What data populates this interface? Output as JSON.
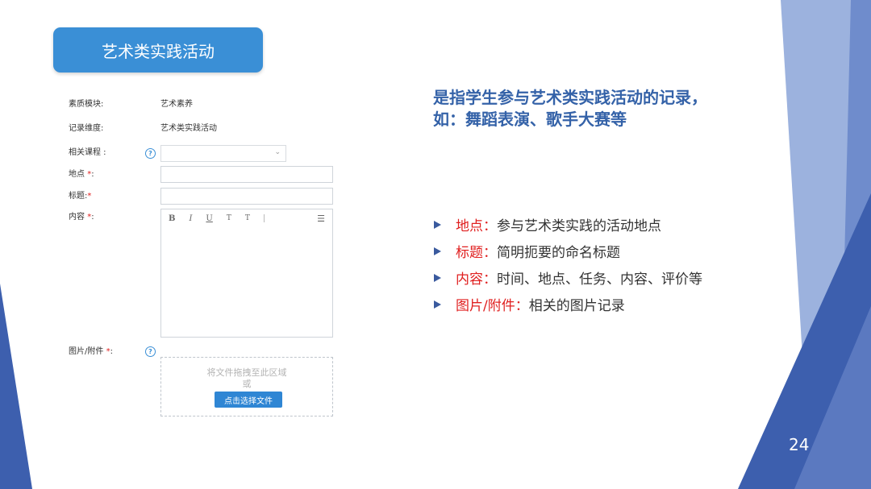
{
  "slide": {
    "title": "艺术类实践活动",
    "page_number": "24"
  },
  "form": {
    "quality_module": {
      "label": "素质模块:",
      "value": "艺术素养"
    },
    "record_dimension": {
      "label": "记录维度:",
      "value": "艺术类实践活动"
    },
    "related_course": {
      "label": "相关课程  :"
    },
    "location": {
      "label": "地点",
      "required_mark": "*",
      "suffix": ":"
    },
    "title_field": {
      "label": "标题:",
      "required_mark": "*"
    },
    "content": {
      "label": "内容",
      "required_mark": "*",
      "suffix": ":"
    },
    "attachment": {
      "label": "图片/附件",
      "required_mark": "*",
      "suffix": ":"
    },
    "help_glyph": "?",
    "editor_toolbar": [
      "B",
      "I",
      "U",
      "T",
      "T"
    ],
    "editor_menu_glyph": "☰",
    "select_chevron": "⌄",
    "dropzone": {
      "hint": "将文件拖拽至此区域",
      "or": "或",
      "button_label": "点击选择文件"
    }
  },
  "description": "是指学生参与艺术类实践活动的记录，如：舞蹈表演、歌手大赛等",
  "bullets": [
    {
      "key": "地点",
      "sep": "：",
      "text": "参与艺术类实践的活动地点"
    },
    {
      "key": "标题",
      "sep": "：",
      "text": "简明扼要的命名标题"
    },
    {
      "key": "内容",
      "sep": "：",
      "text": "时间、地点、任务、内容、评价等"
    },
    {
      "key": "图片/附件",
      "sep": "：",
      "text": "相关的图片记录"
    }
  ],
  "colors": {
    "title_bg": "#3a8fd6",
    "description_text": "#3462a8",
    "bullet_key": "#e02020",
    "decor_dark": "#3a5a9e",
    "decor_light": "#8ea6d6"
  }
}
